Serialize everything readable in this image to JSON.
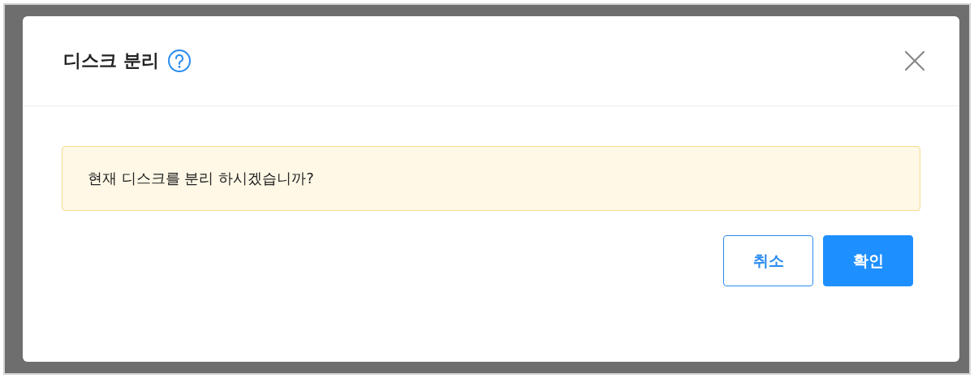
{
  "dialog": {
    "title": "디스크 분리"
  },
  "alert": {
    "message": "현재 디스크를 분리 하시겠습니까?"
  },
  "buttons": [
    {
      "label": "취소",
      "kind": "secondary"
    },
    {
      "label": "확인",
      "kind": "primary"
    }
  ]
}
